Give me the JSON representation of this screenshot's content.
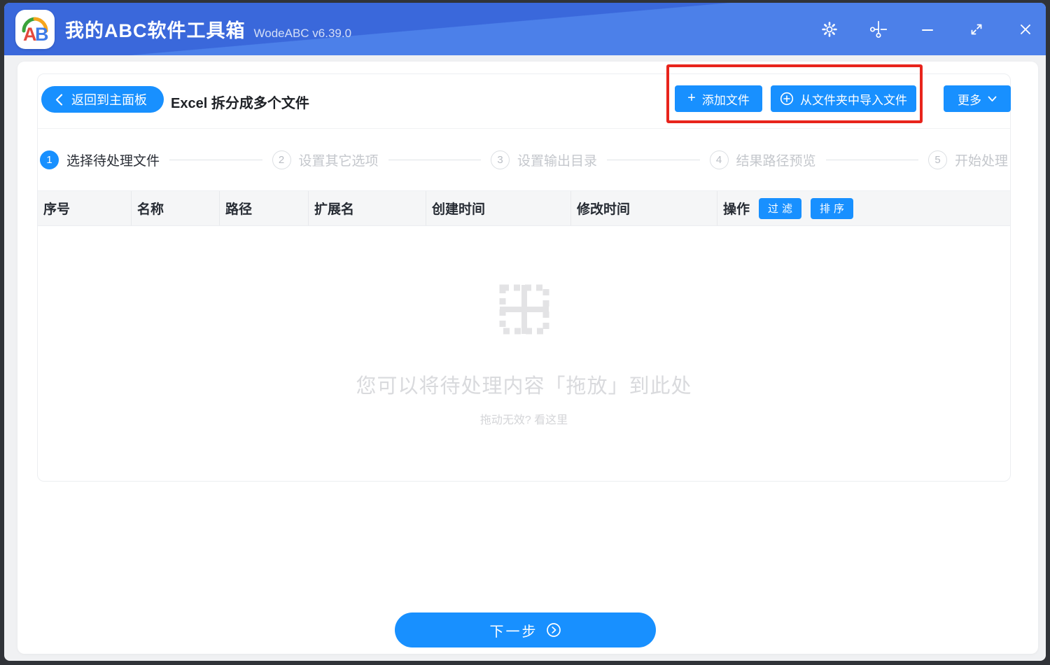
{
  "titlebar": {
    "logo_letter_a": "A",
    "logo_letter_b": "B",
    "app_title": "我的ABC软件工具箱",
    "version": "WodeABC v6.39.0"
  },
  "header": {
    "back_label": "返回到主面板",
    "page_title": "Excel 拆分成多个文件",
    "add_files_icon": "+",
    "add_files_label": "添加文件",
    "import_folder_label": "从文件夹中导入文件",
    "more_label": "更多"
  },
  "steps": [
    {
      "num": "1",
      "label": "选择待处理文件",
      "active": true
    },
    {
      "num": "2",
      "label": "设置其它选项",
      "active": false
    },
    {
      "num": "3",
      "label": "设置输出目录",
      "active": false
    },
    {
      "num": "4",
      "label": "结果路径预览",
      "active": false
    },
    {
      "num": "5",
      "label": "开始处理",
      "active": false
    }
  ],
  "table": {
    "columns": [
      "序号",
      "名称",
      "路径",
      "扩展名",
      "创建时间",
      "修改时间",
      "操作"
    ],
    "filter_label": "过滤",
    "sort_label": "排序",
    "rows": []
  },
  "dropzone": {
    "main_text": "您可以将待处理内容「拖放」到此处",
    "hint_text": "拖动无效? 看这里"
  },
  "footer": {
    "next_label": "下一步"
  },
  "colors": {
    "primary": "#1890ff",
    "titlebar_top": "#3a68db",
    "titlebar_bottom": "#4c80e9",
    "annotation_red": "#e8241c"
  }
}
